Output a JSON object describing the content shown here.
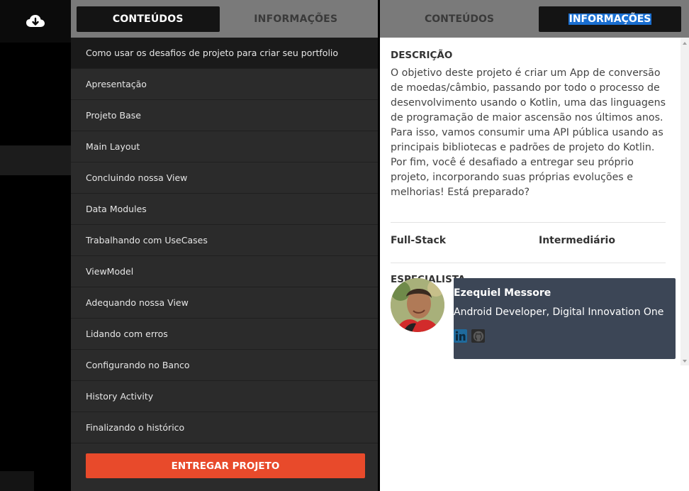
{
  "left_tabs": {
    "contents": "CONTEÚDOS",
    "info": "INFORMAÇÕES"
  },
  "right_tabs": {
    "contents": "CONTEÚDOS",
    "info": "INFORMAÇÕES"
  },
  "lessons": [
    "Como usar os desafios de projeto para criar seu portfolio",
    "Apresentação",
    "Projeto Base",
    "Main Layout",
    "Concluindo nossa View",
    "Data Modules",
    "Trabalhando com UseCases",
    "ViewModel",
    "Adequando nossa View",
    "Lidando com erros",
    "Configurando no Banco",
    "History Activity",
    "Finalizando o histórico"
  ],
  "submit_label": "ENTREGAR PROJETO",
  "description": {
    "title": "DESCRIÇÃO",
    "text": "O objetivo deste projeto é criar um App de conversão de moedas/câmbio, passando por todo o processo de desenvolvimento usando o Kotlin, uma das linguagens de programação de maior ascensão nos últimos anos. Para isso, vamos consumir uma API pública usando as principais bibliotecas e padrões de projeto do Kotlin. Por fim, você é desafiado a entregar seu próprio projeto, incorporando suas próprias evoluções e melhorias! Está preparado?"
  },
  "meta": {
    "track": "Full-Stack",
    "level": "Intermediário"
  },
  "specialist": {
    "title": "ESPECIALISTA",
    "name": "Ezequiel Messore",
    "role": "Android Developer, Digital Innovation One"
  },
  "icons": {
    "download": "cloud-download-icon",
    "linkedin": "linkedin-icon",
    "github": "github-icon"
  },
  "colors": {
    "accent": "#e84a2b",
    "tab_bar": "#7a7a7a",
    "card": "#3c4656",
    "selection": "#1a6fd1"
  }
}
